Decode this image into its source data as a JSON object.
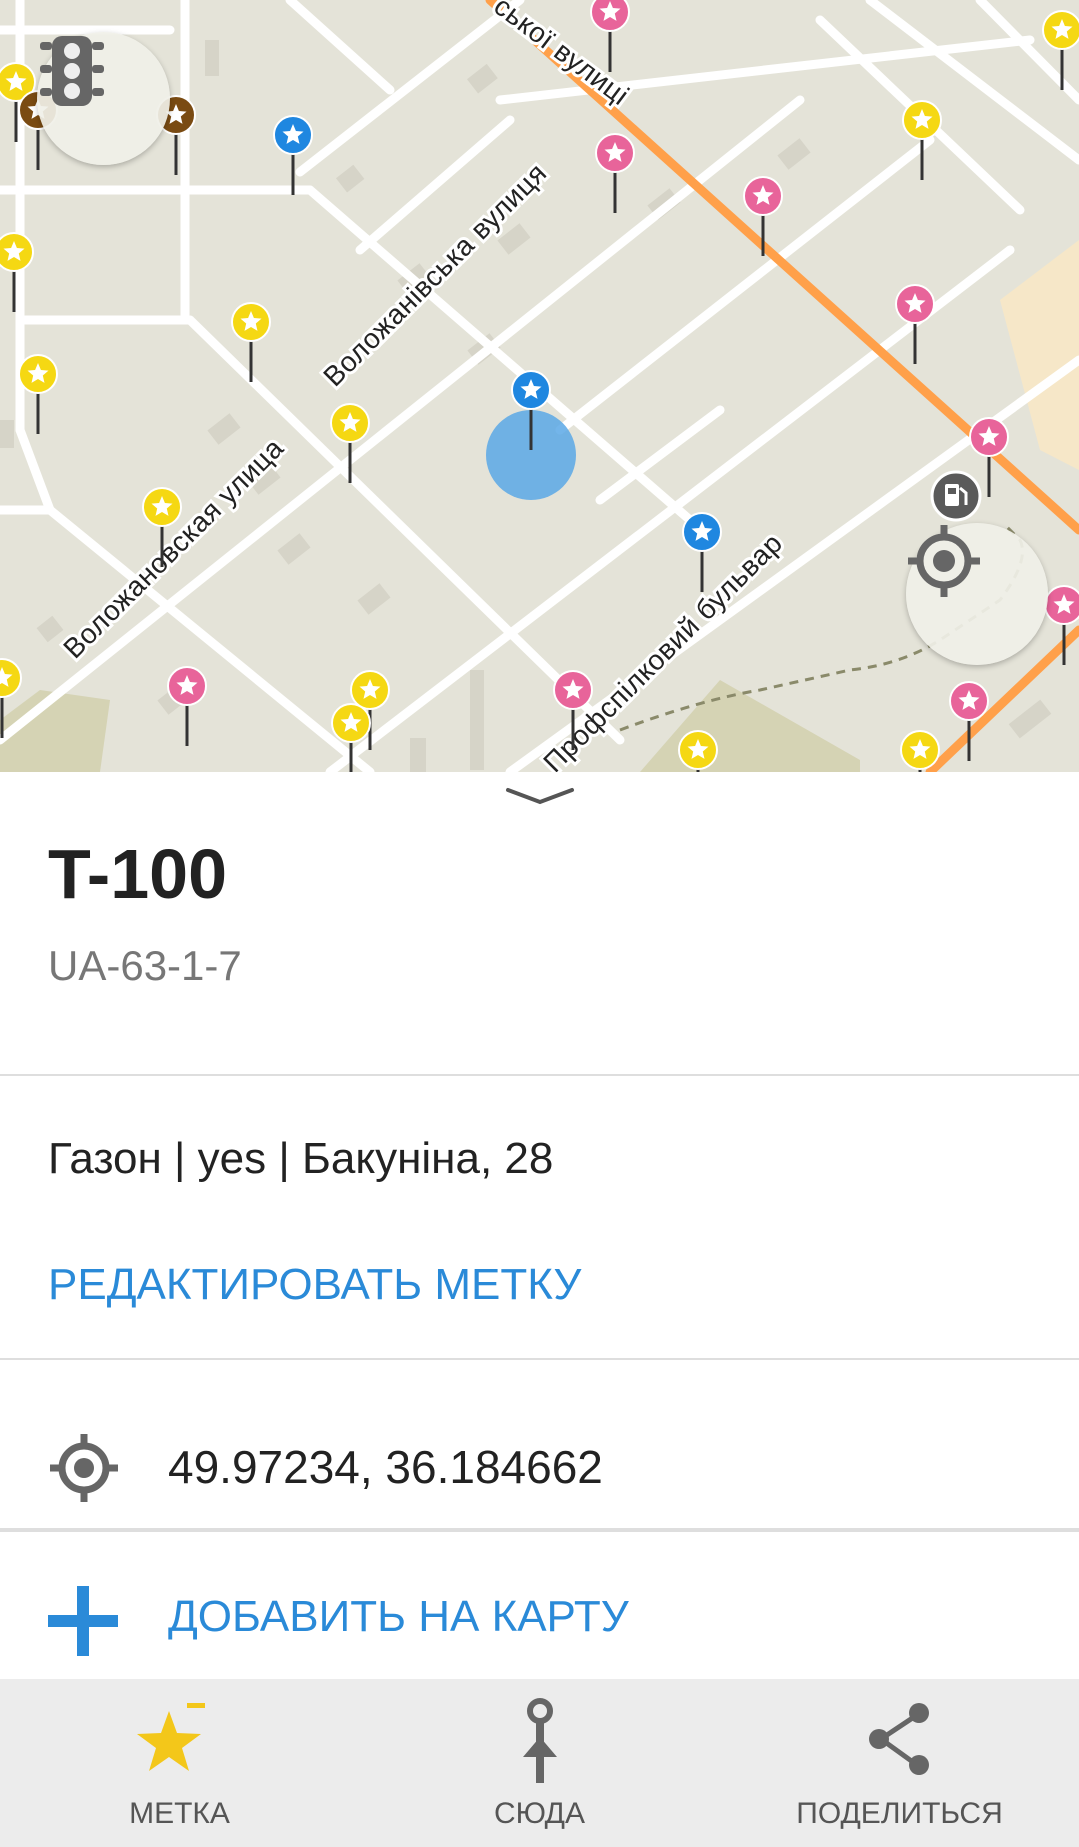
{
  "map": {
    "streets": {
      "top_street": "ської вулиці",
      "volozhanivska_ua": "Воложанівська вулиця",
      "volozhanovskaya_ru": "Воложановская улица",
      "profspilkovyi": "Профспілковий бульвар"
    },
    "colors": {
      "pink": "#e8649a",
      "yellow": "#f5d813",
      "blue": "#1f87e0",
      "brown": "#7a4b12",
      "route": "#ffa04a"
    }
  },
  "place": {
    "title": "T-100",
    "subtitle": "UA-63-1-7",
    "details": "Газон | yes | Бакуніна, 28",
    "edit_label": "РЕДАКТИРОВАТЬ МЕТКУ",
    "coordinates": "49.97234, 36.184662",
    "add_label": "ДОБАВИТЬ НА КАРТУ"
  },
  "tabs": [
    {
      "label": "МЕТКА",
      "icon": "star-bookmark-icon",
      "accent": "#f3c71a"
    },
    {
      "label": "СЮДА",
      "icon": "route-to-icon"
    },
    {
      "label": "ПОДЕЛИТЬСЯ",
      "icon": "share-icon"
    }
  ]
}
